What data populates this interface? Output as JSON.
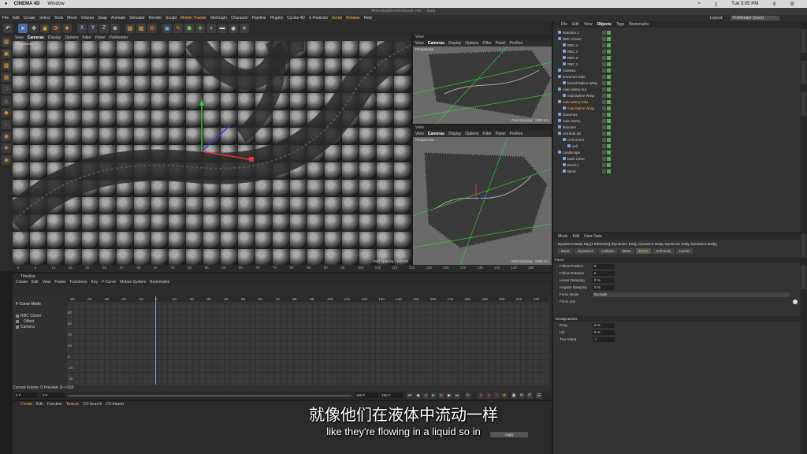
{
  "mac_menu": {
    "apple": "",
    "app": "CINEMA 4D",
    "window": "Window",
    "time": "Tue 3:05 PM"
  },
  "window_title": "AnimatedBloodInVessel.c4d * - Main",
  "main_menu": [
    "File",
    "Edit",
    "Create",
    "Select",
    "Tools",
    "Mesh",
    "Volume",
    "Snap",
    "Animate",
    "Simulate",
    "Render",
    "Sculpt",
    "Motion Tracker",
    "MoGraph",
    "Character",
    "Pipeline",
    "Plugins",
    "Cycles 4D",
    "X-Particles",
    "Script",
    "Window",
    "Help"
  ],
  "layout": {
    "label": "Layout:",
    "value": "ProRender (User)"
  },
  "viewports": {
    "main": {
      "menu": [
        "View",
        "Cameras",
        "Display",
        "Options",
        "Filter",
        "Panel",
        "ProRender"
      ],
      "label": "Perspective",
      "grid": "Grid Spacing : 100 cm"
    },
    "top_right": {
      "title": "View",
      "menu": [
        "View",
        "Cameras",
        "Display",
        "Options",
        "Filter",
        "Panel",
        "ProRen"
      ],
      "label": "Perspective",
      "grid": "Grid Spacing : 1000 cm"
    },
    "bottom_right": {
      "title": "View",
      "menu": [
        "View",
        "Cameras",
        "Display",
        "Options",
        "Filter",
        "Panel",
        "ProRen"
      ],
      "label": "Perspective",
      "grid": "Grid Spacing : 1000 cm"
    }
  },
  "ruler_ticks": [
    "0",
    "5",
    "10",
    "15",
    "20",
    "25",
    "30",
    "35",
    "40",
    "45",
    "50",
    "55",
    "60",
    "65",
    "70",
    "75",
    "80",
    "85",
    "90",
    "95",
    "100",
    "105",
    "110",
    "115",
    "120",
    "125",
    "130",
    "135",
    "140",
    "145",
    "150"
  ],
  "timeline": {
    "title": "Timeline",
    "menu": [
      "Edit",
      "View",
      "Frame",
      "Functions",
      "Key",
      "F-Curve",
      "Motion System",
      "Bookmarks"
    ],
    "menu_prefix": "Create",
    "mode": "F-Curve Mode",
    "tracks": [
      "RBC Cloner",
      "Offset",
      "Camera"
    ],
    "header_ticks": [
      "-50",
      "-40",
      "-30",
      "-20",
      "-10",
      "0",
      "10",
      "20",
      "30",
      "40",
      "50",
      "60",
      "70",
      "80",
      "90",
      "100",
      "110",
      "120",
      "130",
      "140",
      "150",
      "160",
      "170",
      "180",
      "190",
      "200",
      "210",
      "220"
    ],
    "y_ticks": [
      "80",
      "60",
      "40",
      "20",
      "0",
      "-20",
      "-40"
    ],
    "current_frame": "Current Frame: 0  Preview: 0-->150"
  },
  "transport": {
    "start": "0 F",
    "field2": "0 F",
    "end": "150 F",
    "end2": "150 F"
  },
  "material": {
    "menu": [
      "Create",
      "Edit",
      "Function",
      "Texture",
      "CV-Search",
      "CV-Import"
    ],
    "apply": "Apply"
  },
  "objects": {
    "menu": [
      "File",
      "Edit",
      "View",
      "Objects",
      "Tags",
      "Bookmarks"
    ],
    "rows": [
      {
        "name": "Random.1",
        "indent": 0,
        "sel": false
      },
      {
        "name": "RBC Cloner",
        "indent": 0,
        "sel": false
      },
      {
        "name": "RBC.4",
        "indent": 1,
        "sel": false
      },
      {
        "name": "RBC.3",
        "indent": 1,
        "sel": false
      },
      {
        "name": "RBC.2",
        "indent": 1,
        "sel": false
      },
      {
        "name": "RBC.1",
        "indent": 1,
        "sel": false
      },
      {
        "name": "Camera",
        "indent": 0,
        "sel": false
      },
      {
        "name": "branches tube",
        "indent": 0,
        "sel": false
      },
      {
        "name": "branchSpline Wrap",
        "indent": 1,
        "sel": false
      },
      {
        "name": "main artery out",
        "indent": 0,
        "sel": false
      },
      {
        "name": "mainSpline Wrap",
        "indent": 1,
        "sel": false
      },
      {
        "name": "main artery tube",
        "indent": 0,
        "sel": true
      },
      {
        "name": "mainSpline Wrap",
        "indent": 1,
        "sel": true
      },
      {
        "name": "branches",
        "indent": 0,
        "sel": false
      },
      {
        "name": "main artery",
        "indent": 0,
        "sel": false
      },
      {
        "name": "Random",
        "indent": 0,
        "sel": false
      },
      {
        "name": "cell field 3D",
        "indent": 0,
        "sel": false
      },
      {
        "name": "Cell cloner",
        "indent": 1,
        "sel": false
      },
      {
        "name": "cell",
        "indent": 2,
        "sel": false
      },
      {
        "name": "Landscape",
        "indent": 0,
        "sel": false
      },
      {
        "name": "back curve",
        "indent": 1,
        "sel": false
      },
      {
        "name": "Bend.1",
        "indent": 1,
        "sel": false
      },
      {
        "name": "Bend",
        "indent": 1,
        "sel": false
      }
    ]
  },
  "attributes": {
    "menu": [
      "Mode",
      "Edit",
      "User Data"
    ],
    "title": "Dynamics Body Tag [4 Elements] (Dynamics Body, Dynamics Body, Dynamics Body, Dynamics Body)",
    "tabs": [
      "Basic",
      "Dynamics",
      "Collision",
      "Mass",
      "Force",
      "Soft Body",
      "Cache"
    ],
    "active_tab": "Force",
    "force_section": "Force",
    "force_props": [
      {
        "k": "Follow Position",
        "v": "0"
      },
      {
        "k": "Follow Rotation",
        "v": "0"
      },
      {
        "k": "Linear Damping",
        "v": "0 %"
      },
      {
        "k": "Angular Damping",
        "v": "0 %"
      }
    ],
    "force_mode": {
      "k": "Force Mode",
      "v": "Exclude"
    },
    "force_list": "Force List",
    "aero_section": "Aerodynamics",
    "aero_props": [
      {
        "k": "Drag",
        "v": "0 %"
      },
      {
        "k": "Lift",
        "v": "0 %"
      },
      {
        "k": "Two-Sided",
        "v": "✓"
      }
    ]
  },
  "subtitles": {
    "cn": "就像他们在液体中流动一样",
    "en": "like they're flowing in a liquid so in"
  }
}
